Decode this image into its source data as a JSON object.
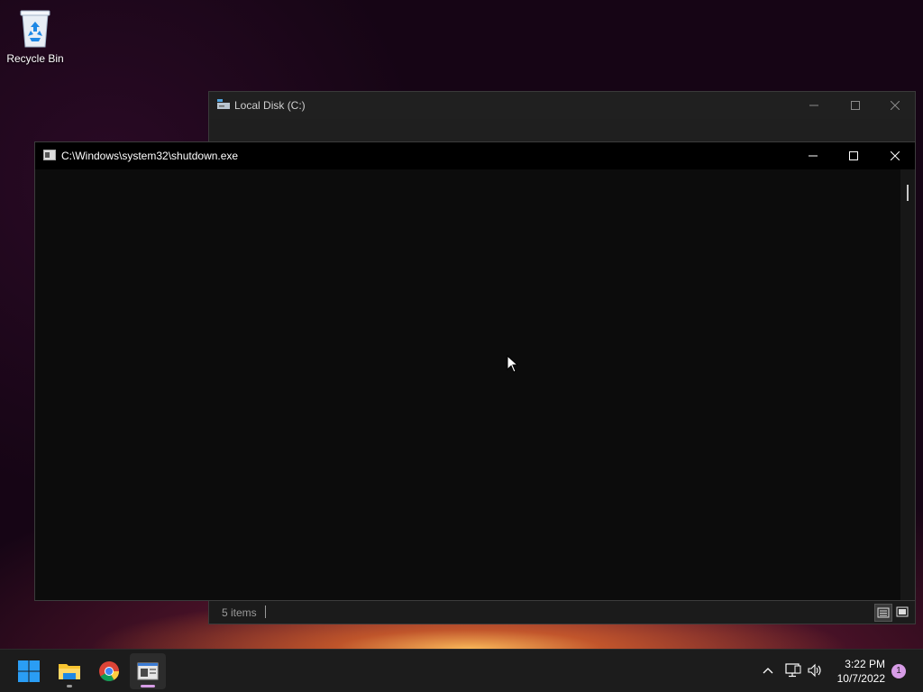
{
  "desktop": {
    "recycle_bin_label": "Recycle Bin"
  },
  "explorer": {
    "title": "Local Disk (C:)",
    "status_items": "5 items"
  },
  "console": {
    "title": "C:\\Windows\\system32\\shutdown.exe"
  },
  "taskbar": {
    "apps": [
      "start",
      "file-explorer",
      "chrome",
      "shutdown-console"
    ],
    "time": "3:22 PM",
    "date": "10/7/2022",
    "notification_count": "1"
  },
  "colors": {
    "accent": "#0078d4",
    "notification": "#d79ce6"
  }
}
